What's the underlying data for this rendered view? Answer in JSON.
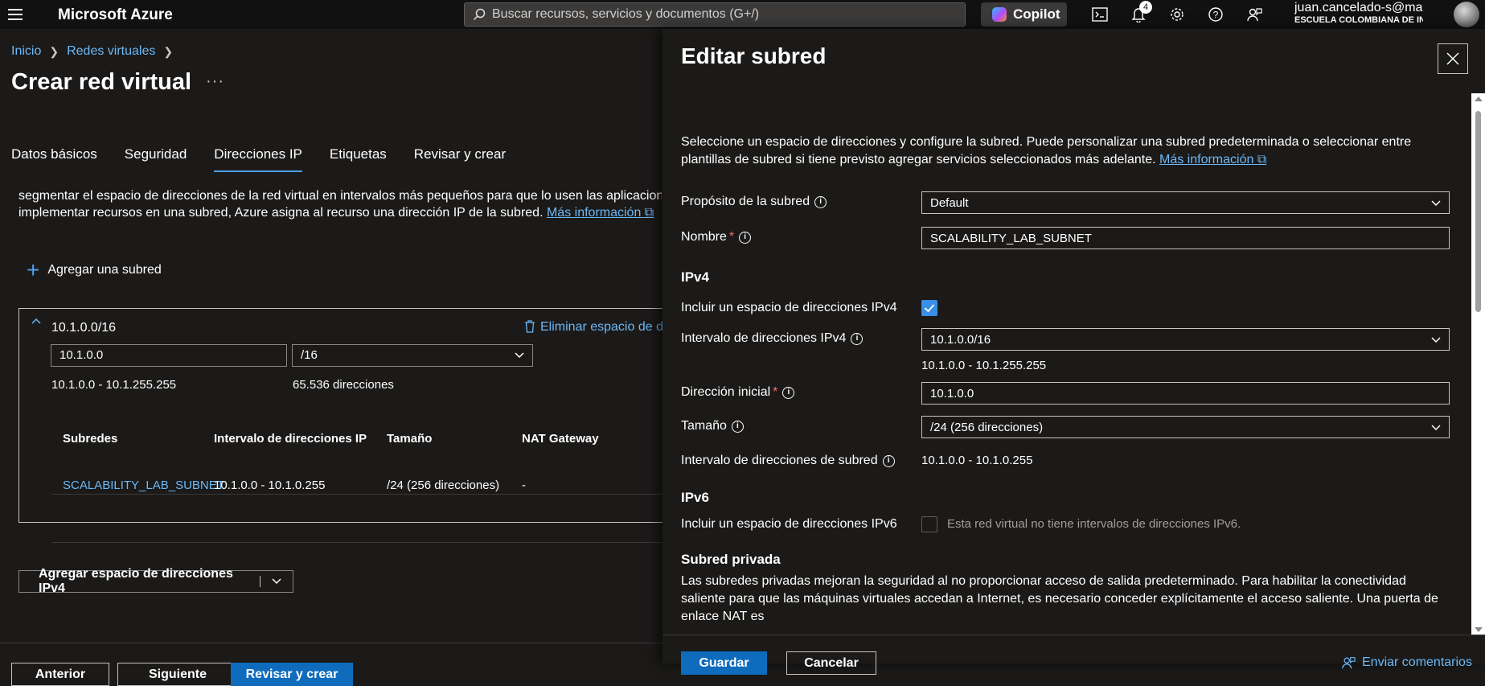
{
  "topbar": {
    "brand": "Microsoft Azure",
    "search_placeholder": "Buscar recursos, servicios y documentos (G+/)",
    "copilot_label": "Copilot",
    "notifications_count": "4",
    "account_email": "juan.cancelado-s@mail....",
    "account_org": "ESCUELA COLOMBIANA DE INGE..."
  },
  "breadcrumb": {
    "items": [
      "Inicio",
      "Redes virtuales"
    ]
  },
  "page": {
    "title": "Crear red virtual",
    "more": "···"
  },
  "tabs": [
    "Datos básicos",
    "Seguridad",
    "Direcciones IP",
    "Etiquetas",
    "Revisar y crear"
  ],
  "active_tab": "Direcciones IP",
  "description": {
    "line1": "segmentar el espacio de direcciones de la red virtual en intervalos más pequeños para que lo usen las aplicaciones. A",
    "line2": "implementar recursos en una subred, Azure asigna al recurso una dirección IP de la subred.",
    "link": "Más información"
  },
  "add_subnet_label": "Agregar una subred",
  "address_space": {
    "title": "10.1.0.0/16",
    "delete_label": "Eliminar espacio de di",
    "start_ip": "10.1.0.0",
    "prefix": "/16",
    "range": "10.1.0.0 - 10.1.255.255",
    "count": "65.536 direcciones"
  },
  "subnet_table": {
    "headers": [
      "Subredes",
      "Intervalo de direcciones IP",
      "Tamaño",
      "NAT Gateway"
    ],
    "rows": [
      [
        "SCALABILITY_LAB_SUBNET",
        "10.1.0.0 - 10.1.0.255",
        "/24 (256 direcciones)",
        "-"
      ]
    ]
  },
  "add_ipv4_label": "Agregar espacio de direcciones IPv4",
  "footer": {
    "prev": "Anterior",
    "next": "Siguiente",
    "review": "Revisar y crear"
  },
  "panel": {
    "title": "Editar subred",
    "intro": "Seleccione un espacio de direcciones y configure la subred. Puede personalizar una subred predeterminada o seleccionar entre plantillas de subred si tiene previsto agregar servicios seleccionados más adelante.",
    "intro_link": "Más información",
    "purpose_label": "Propósito de la subred",
    "purpose_value": "Default",
    "name_label": "Nombre",
    "name_value": "SCALABILITY_LAB_SUBNET",
    "ipv4_section": "IPv4",
    "ipv4_include_label": "Incluir un espacio de direcciones IPv4",
    "ipv4_range_label": "Intervalo de direcciones IPv4",
    "ipv4_range_value": "10.1.0.0/16",
    "ipv4_range_hint": "10.1.0.0 - 10.1.255.255",
    "start_label": "Dirección inicial",
    "start_value": "10.1.0.0",
    "size_label": "Tamaño",
    "size_value": "/24 (256 direcciones)",
    "subnet_range_label": "Intervalo de direcciones de subred",
    "subnet_range_value": "10.1.0.0 - 10.1.0.255",
    "ipv6_section": "IPv6",
    "ipv6_include_label": "Incluir un espacio de direcciones IPv6",
    "ipv6_note": "Esta red virtual no tiene intervalos de direcciones IPv6.",
    "private_section": "Subred privada",
    "private_text": "Las subredes privadas mejoran la seguridad al no proporcionar acceso de salida predeterminado. Para habilitar la conectividad saliente para que las máquinas virtuales accedan a Internet, es necesario conceder explícitamente el acceso saliente. Una puerta de enlace NAT es",
    "save": "Guardar",
    "cancel": "Cancelar",
    "feedback": "Enviar comentarios"
  },
  "colors": {
    "accent": "#0f6cbd",
    "link": "#6cb8f6",
    "background": "#1b1a19",
    "topbar": "#111111",
    "checkbox": "#3a8ee6"
  }
}
